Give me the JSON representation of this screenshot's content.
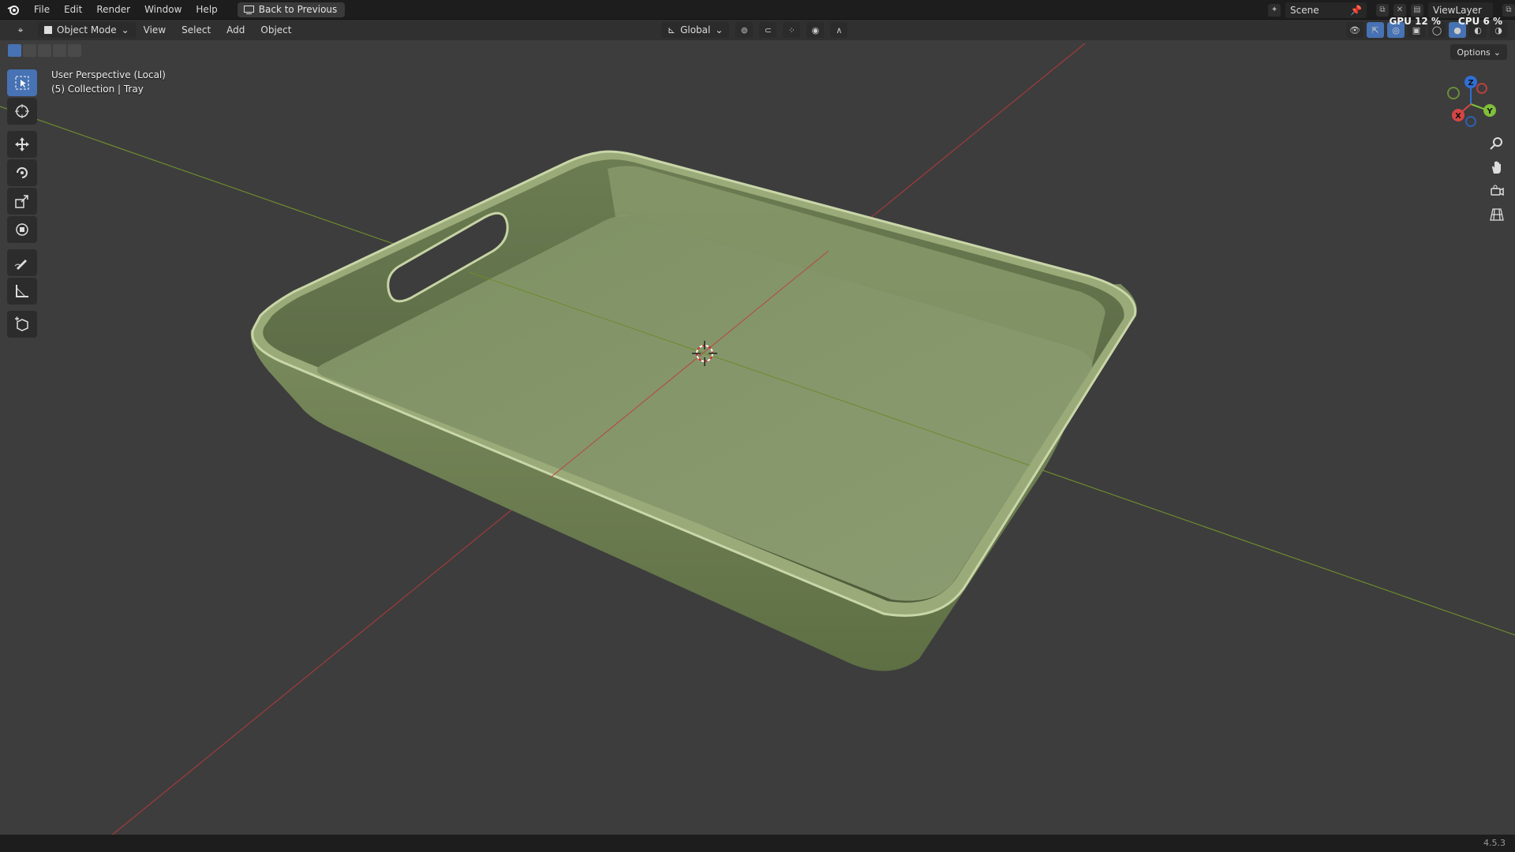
{
  "menubar": {
    "items": [
      "File",
      "Edit",
      "Render",
      "Window",
      "Help"
    ],
    "back_button": "Back to Previous",
    "scene": "Scene",
    "view_layer": "ViewLayer"
  },
  "stats": {
    "gpu": "GPU 12 %",
    "cpu": "CPU 6 %"
  },
  "header": {
    "mode": "Object Mode",
    "menus": [
      "View",
      "Select",
      "Add",
      "Object"
    ],
    "transform_orientation": "Global",
    "options": "Options"
  },
  "viewport": {
    "perspective_label": "User Perspective (Local)",
    "collection_label": "(5) Collection | Tray",
    "object_color": "#8a9a6a"
  },
  "gizmo": {
    "x": "X",
    "y": "Y",
    "z": "Z"
  },
  "status": {
    "version": "4.5.3"
  }
}
